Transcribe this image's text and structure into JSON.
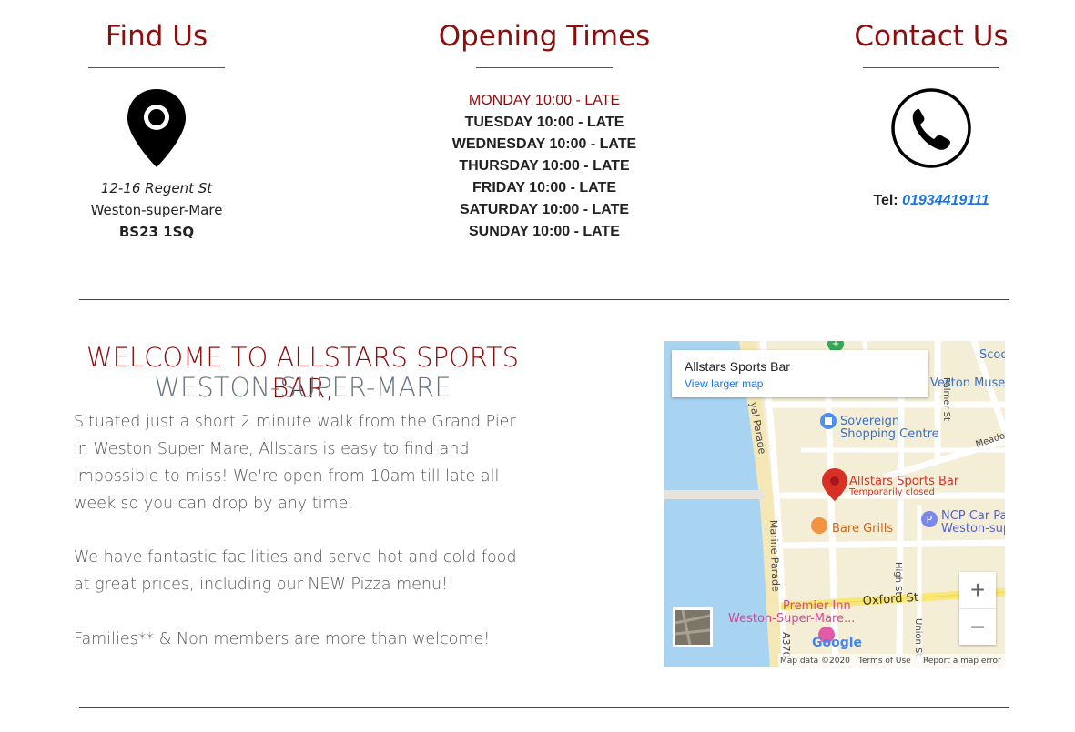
{
  "find_us": {
    "title": "Find Us",
    "icon": "location-pin-icon",
    "address_line1": "12-16 Regent St",
    "address_line2": "Weston-super-Mare",
    "postcode": "BS23 1SQ"
  },
  "opening_times": {
    "title": "Opening Times",
    "days": [
      "MONDAY 10:00 - LATE",
      "TUESDAY 10:00 - LATE",
      "WEDNESDAY 10:00 - LATE",
      "THURSDAY 10:00 - LATE",
      "FRIDAY 10:00 - LATE",
      "SATURDAY 10:00 - LATE",
      "SUNDAY 10:00 - LATE"
    ]
  },
  "contact_us": {
    "title": "Contact Us",
    "icon": "phone-icon",
    "tel_label": "Tel:",
    "tel_number": "01934419111"
  },
  "welcome": {
    "heading_line1": "WELCOME TO ALLSTARS SPORTS BAR,",
    "heading_line2": "WESTON-SUPER-MARE",
    "paragraph1": "Situated just a short 2 minute walk from the Grand Pier in Weston Super Mare, Allstars is easy to find and impossible to miss! We're open from 10am till late all week so you can drop by any time.",
    "paragraph2": "We have fantastic facilities and serve hot and cold food at great prices, including our NEW Pizza menu!!",
    "paragraph3": "Families** & Non members are more than welcome!"
  },
  "map": {
    "place_name": "Allstars Sports Bar",
    "larger_map_link": "View larger map",
    "pin_label": "Allstars Sports Bar",
    "pin_status": "Temporarily closed",
    "labels": {
      "sovereign1": "Sovereign",
      "sovereign2": "Shopping Centre",
      "bare_grills": "Bare Grills",
      "ncp1": "NCP Car Pa",
      "ncp2": "Weston-sup",
      "premier1": "Premier Inn",
      "premier2": "Weston-Super-Mare...",
      "oxford": "Oxford St",
      "marine": "Marine Parade",
      "royal": "yal Parade",
      "high": "High St",
      "union": "Union St",
      "palmer": "Palmer St",
      "meadow": "Meado",
      "museum": "Veston Museu",
      "scoo": "Scoo",
      "a370": "A370"
    },
    "footer": {
      "map_data": "Map data ©2020",
      "terms": "Terms of Use",
      "report": "Report a map error"
    },
    "google_logo": "Google",
    "zoom_in": "+",
    "zoom_out": "−"
  },
  "colors": {
    "accent": "#8b0d0d",
    "link": "#1a73e8"
  }
}
